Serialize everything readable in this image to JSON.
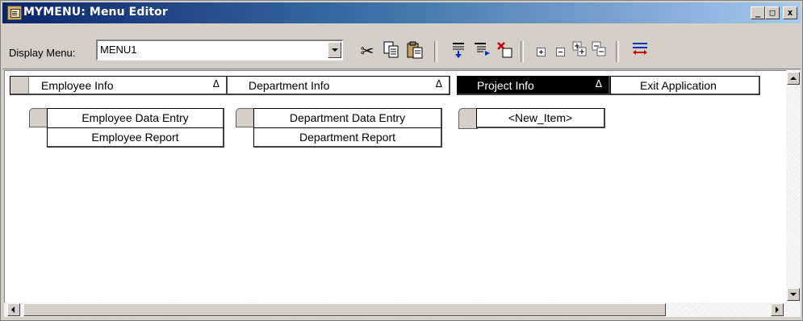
{
  "window": {
    "title": "MYMENU: Menu Editor",
    "controls": {
      "minimize": "_",
      "maximize": "□",
      "close": "x"
    }
  },
  "toolbar": {
    "display_menu_label": "Display Menu:",
    "display_menu_value": "MENU1",
    "icons": [
      "cut-icon",
      "copy-icon",
      "paste-icon",
      "insert-item-icon",
      "insert-submenu-icon",
      "delete-item-icon",
      "expand-icon",
      "collapse-icon",
      "expand-all-icon",
      "collapse-all-icon",
      "swap-icon"
    ]
  },
  "menus": [
    {
      "label": "Employee Info",
      "has_submenu": true,
      "selected": false,
      "items": [
        "Employee Data Entry",
        "Employee Report"
      ]
    },
    {
      "label": "Department Info",
      "has_submenu": true,
      "selected": false,
      "items": [
        "Department Data Entry",
        "Department Report"
      ]
    },
    {
      "label": "Project Info",
      "has_submenu": true,
      "selected": true,
      "items": [
        "<New_Item>"
      ]
    },
    {
      "label": "Exit Application",
      "has_submenu": false,
      "selected": false,
      "items": []
    }
  ],
  "submenu_marker": "Δ",
  "colors": {
    "titlebar_start": "#0a246a",
    "titlebar_end": "#a6caf0",
    "selected_bg": "#000000"
  }
}
